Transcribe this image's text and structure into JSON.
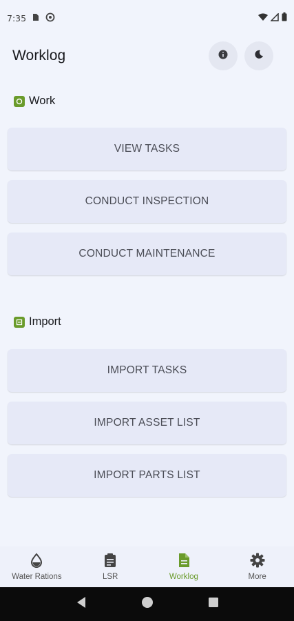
{
  "status_bar": {
    "time": "7:35"
  },
  "header": {
    "title": "Worklog",
    "info_icon": "info-icon",
    "theme_icon": "moon-icon"
  },
  "sections": {
    "work": {
      "title": "Work",
      "buttons": [
        "VIEW TASKS",
        "CONDUCT INSPECTION",
        "CONDUCT MAINTENANCE"
      ]
    },
    "import": {
      "title": "Import",
      "buttons": [
        "IMPORT TASKS",
        "IMPORT ASSET LIST",
        "IMPORT PARTS LIST"
      ]
    }
  },
  "bottom_nav": {
    "items": [
      {
        "label": "Water Rations",
        "icon": "water-drop-icon"
      },
      {
        "label": "LSR",
        "icon": "clipboard-icon"
      },
      {
        "label": "Worklog",
        "icon": "document-icon",
        "active": true
      },
      {
        "label": "More",
        "icon": "gear-icon"
      }
    ]
  },
  "colors": {
    "accent": "#6a9b2b",
    "background": "#f1f4fc",
    "button_bg": "#e6e9f7"
  }
}
